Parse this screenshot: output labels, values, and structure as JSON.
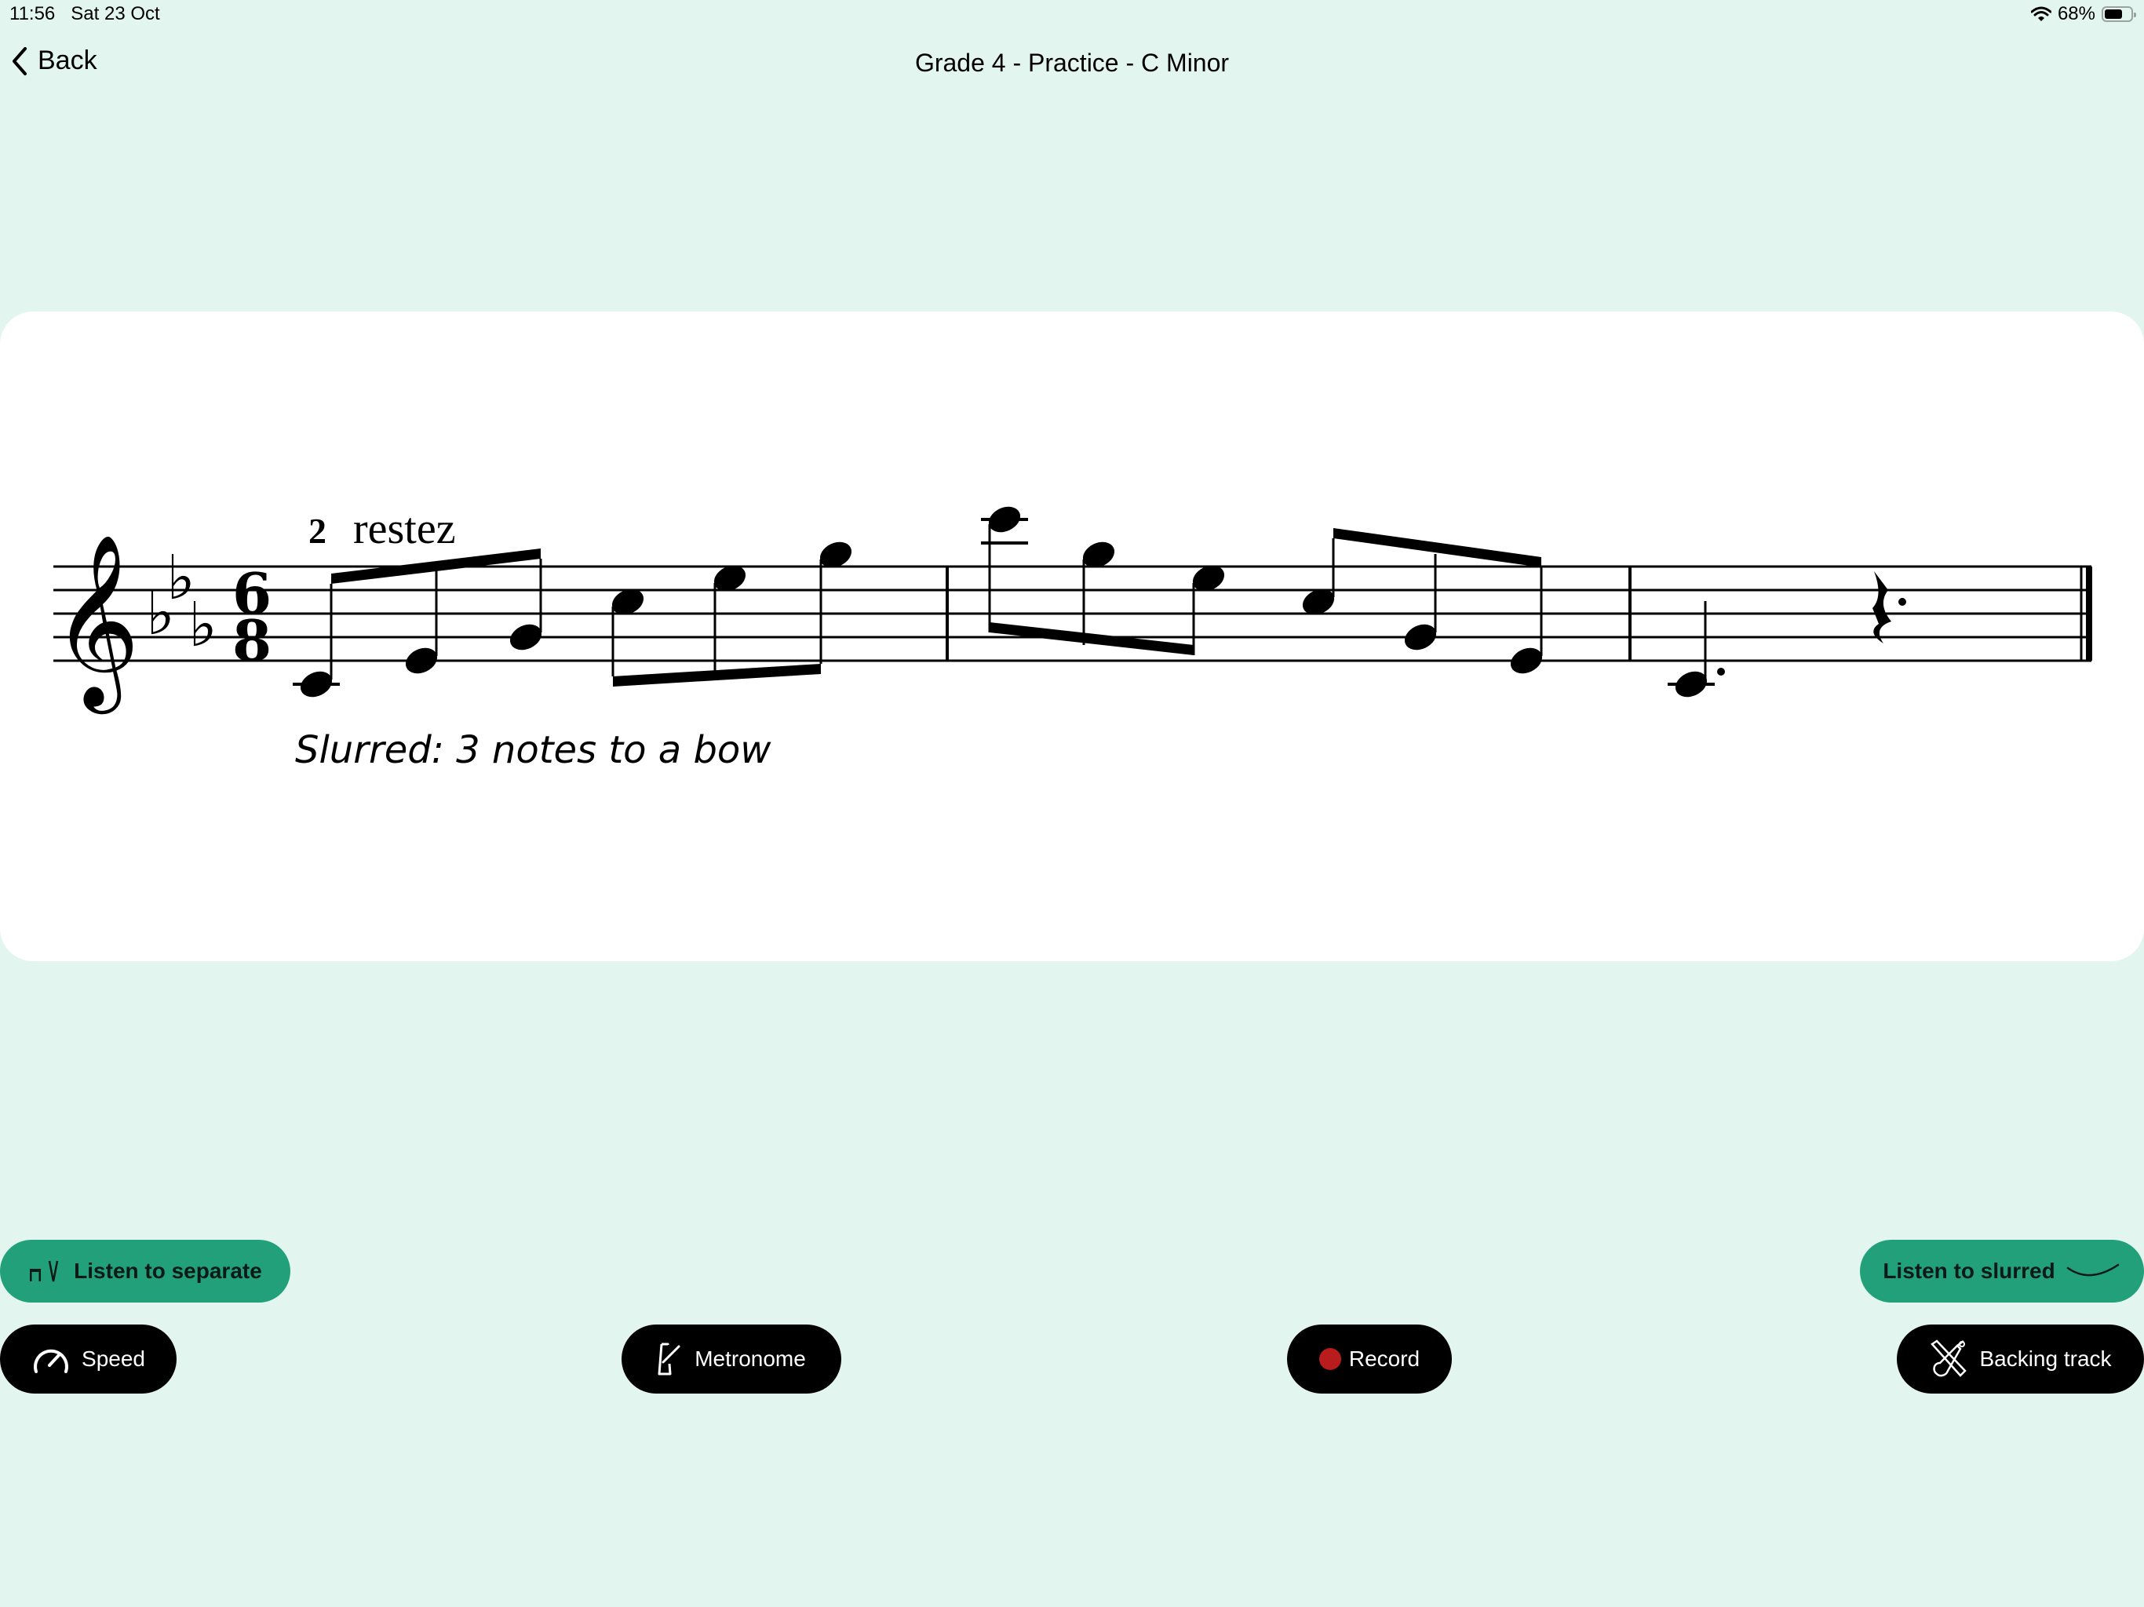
{
  "status_bar": {
    "time": "11:56",
    "date": "Sat 23 Oct",
    "battery_percent": "68%",
    "battery_level": 0.68,
    "wifi_icon": "wifi-icon",
    "battery_icon": "battery-icon"
  },
  "nav": {
    "back_label": "Back",
    "back_icon": "chevron-left-icon",
    "title": "Grade 4 - Practice - C Minor"
  },
  "score": {
    "clef": "treble",
    "key_signature": "C minor (3 flats: Bb, Eb, Ab)",
    "time_signature": {
      "top": "6",
      "bottom": "8"
    },
    "fingering": "2",
    "direction": "restez",
    "instruction": "Slurred: 3 notes to a bow",
    "measures": [
      {
        "notes": [
          {
            "pitch": "C4",
            "duration": "eighth"
          },
          {
            "pitch": "Eb4",
            "duration": "eighth"
          },
          {
            "pitch": "G4",
            "duration": "eighth"
          },
          {
            "pitch": "C5",
            "duration": "eighth"
          },
          {
            "pitch": "Eb5",
            "duration": "eighth"
          },
          {
            "pitch": "G5",
            "duration": "eighth"
          }
        ]
      },
      {
        "notes": [
          {
            "pitch": "C6",
            "duration": "eighth"
          },
          {
            "pitch": "G5",
            "duration": "eighth"
          },
          {
            "pitch": "Eb5",
            "duration": "eighth"
          },
          {
            "pitch": "C5",
            "duration": "eighth"
          },
          {
            "pitch": "G4",
            "duration": "eighth"
          },
          {
            "pitch": "Eb4",
            "duration": "eighth"
          }
        ]
      },
      {
        "notes": [
          {
            "pitch": "C4",
            "duration": "dotted-quarter"
          },
          {
            "pitch": "rest",
            "duration": "dotted-quarter"
          }
        ]
      }
    ]
  },
  "buttons": {
    "listen_separate": {
      "label": "Listen to separate",
      "icon": "down-bow-up-bow-icon"
    },
    "listen_slurred": {
      "label": "Listen to slurred",
      "icon": "slur-icon"
    },
    "speed": {
      "label": "Speed",
      "icon": "speedometer-icon"
    },
    "metronome": {
      "label": "Metronome",
      "icon": "metronome-icon"
    },
    "record": {
      "label": "Record",
      "icon": "record-dot-icon"
    },
    "backing_track": {
      "label": "Backing track",
      "icon": "violin-icon"
    }
  },
  "colors": {
    "background": "#e3f5ef",
    "accent_green": "#22a07a",
    "record_red": "#b81c1c"
  }
}
